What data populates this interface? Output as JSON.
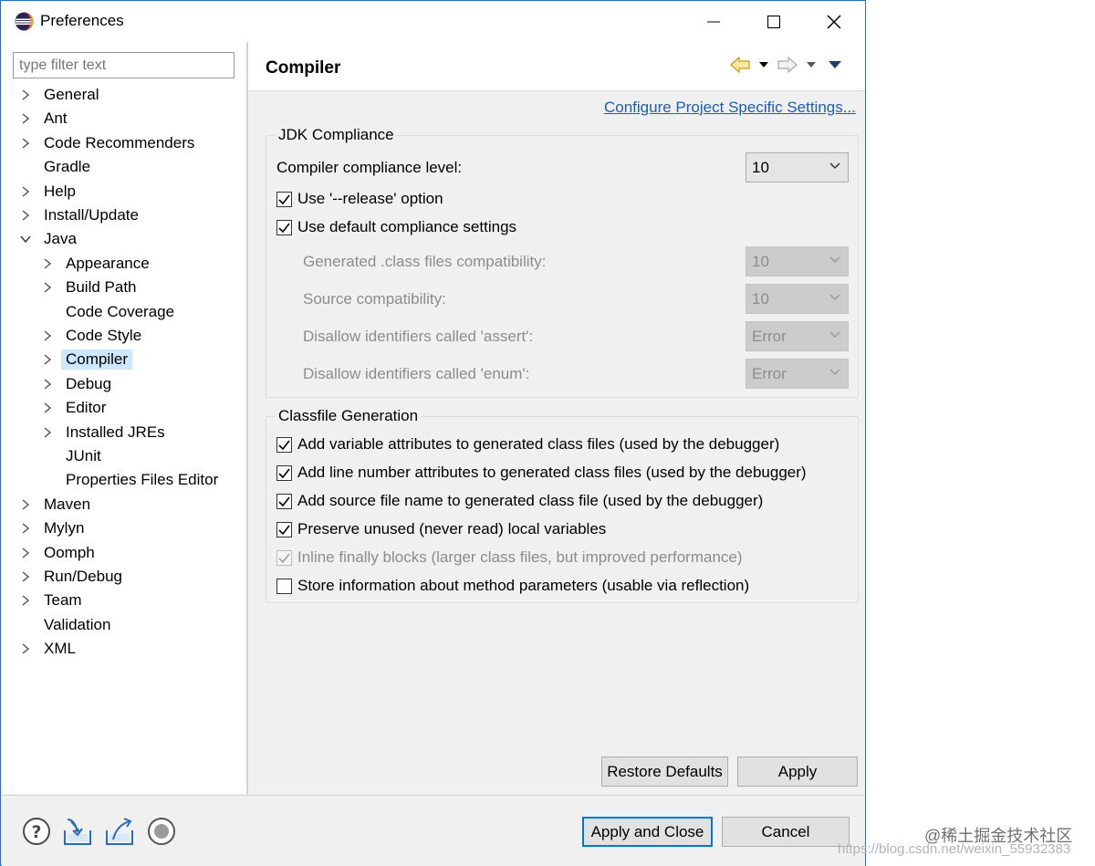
{
  "window": {
    "title": "Preferences"
  },
  "filter": {
    "placeholder": "type filter text"
  },
  "tree": [
    {
      "label": "General",
      "chevron": "right"
    },
    {
      "label": "Ant",
      "chevron": "right"
    },
    {
      "label": "Code Recommenders",
      "chevron": "right"
    },
    {
      "label": "Gradle",
      "chevron": "none"
    },
    {
      "label": "Help",
      "chevron": "right"
    },
    {
      "label": "Install/Update",
      "chevron": "right"
    },
    {
      "label": "Java",
      "chevron": "down"
    },
    {
      "label": "Appearance",
      "chevron": "right"
    },
    {
      "label": "Build Path",
      "chevron": "right"
    },
    {
      "label": "Code Coverage",
      "chevron": "none"
    },
    {
      "label": "Code Style",
      "chevron": "right"
    },
    {
      "label": "Compiler",
      "chevron": "right",
      "selected": true
    },
    {
      "label": "Debug",
      "chevron": "right"
    },
    {
      "label": "Editor",
      "chevron": "right"
    },
    {
      "label": "Installed JREs",
      "chevron": "right"
    },
    {
      "label": "JUnit",
      "chevron": "none"
    },
    {
      "label": "Properties Files Editor",
      "chevron": "none"
    },
    {
      "label": "Maven",
      "chevron": "right"
    },
    {
      "label": "Mylyn",
      "chevron": "right"
    },
    {
      "label": "Oomph",
      "chevron": "right"
    },
    {
      "label": "Run/Debug",
      "chevron": "right"
    },
    {
      "label": "Team",
      "chevron": "right"
    },
    {
      "label": "Validation",
      "chevron": "none"
    },
    {
      "label": "XML",
      "chevron": "right"
    }
  ],
  "page": {
    "title": "Compiler",
    "configure_link": "Configure Project Specific Settings...",
    "jdk": {
      "group_title": "JDK Compliance",
      "compliance_label": "Compiler compliance level:",
      "compliance_value": "10",
      "use_release": "Use '--release' option",
      "use_default": "Use default compliance settings",
      "generated_label": "Generated .class files compatibility:",
      "generated_value": "10",
      "source_label": "Source compatibility:",
      "source_value": "10",
      "assert_label": "Disallow identifiers called 'assert':",
      "assert_value": "Error",
      "enum_label": "Disallow identifiers called 'enum':",
      "enum_value": "Error"
    },
    "classfile": {
      "group_title": "Classfile Generation",
      "opt1": "Add variable attributes to generated class files (used by the debugger)",
      "opt2": "Add line number attributes to generated class files (used by the debugger)",
      "opt3": "Add source file name to generated class file (used by the debugger)",
      "opt4": "Preserve unused (never read) local variables",
      "opt5": "Inline finally blocks (larger class files, but improved performance)",
      "opt6": "Store information about method parameters (usable via reflection)"
    },
    "restore_defaults": "Restore Defaults",
    "apply": "Apply"
  },
  "footer": {
    "apply_close": "Apply and Close",
    "cancel": "Cancel"
  },
  "watermark": {
    "line1": "@稀土掘金技术社区",
    "line2": "https://blog.csdn.net/weixin_55932383"
  },
  "colors": {
    "accent": "#0078d7",
    "link": "#1b5fb0",
    "selection": "#cce8ff"
  }
}
